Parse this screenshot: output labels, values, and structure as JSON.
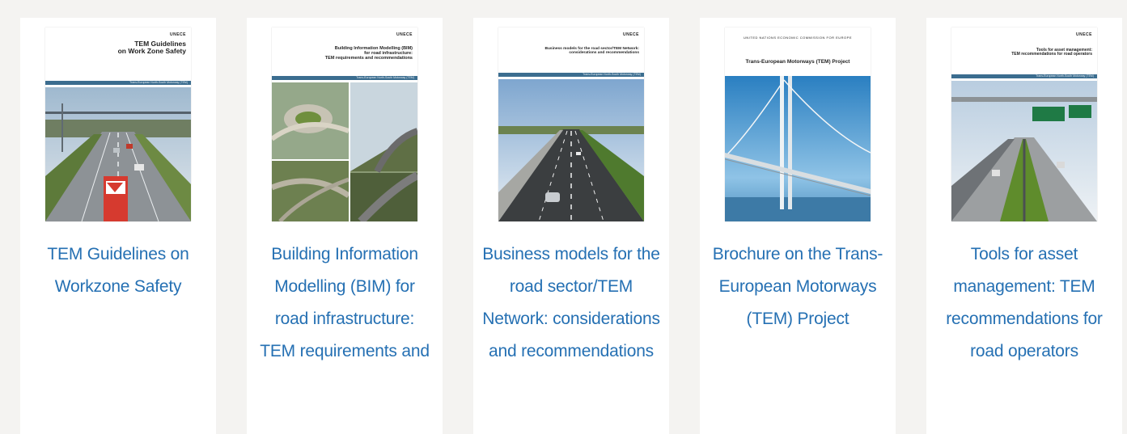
{
  "publications": [
    {
      "cover_brand": "UNECE",
      "cover_title_line1": "TEM Guidelines",
      "cover_title_line2": "on Work Zone Safety",
      "cover_band": "Trans-European North-South Motorway (TEM)",
      "label": "TEM Guidelines on Workzone Safety"
    },
    {
      "cover_brand": "UNECE",
      "cover_title_line1": "Building Information Modelling (BIM)",
      "cover_title_line2": "for road infrastructure:",
      "cover_title_line3": "TEM requirements and recommendations",
      "cover_band": "Trans-European North-South Motorway (TEM)",
      "label": "Building Information Modelling (BIM) for road infrastructure: TEM requirements and"
    },
    {
      "cover_brand": "UNECE",
      "cover_title_line1": "Business models for the road sector/TEM Network:",
      "cover_title_line2": "considerations and recommendations",
      "cover_band": "Trans-European North-South Motorway (TEM)",
      "label": "Business models for the road sector/TEM Network: considerations and recommendations"
    },
    {
      "cover_brand": "UNITED NATIONS ECONOMIC COMMISSION FOR EUROPE",
      "cover_title_line1": "Trans-European Motorways (TEM) Project",
      "label": "Brochure on the Trans-European Motorways (TEM) Project"
    },
    {
      "cover_brand": "UNECE",
      "cover_title_line1": "Tools for asset management:",
      "cover_title_line2": "TEM recommendations for road operators",
      "cover_band": "Trans-European North-South Motorway (TEM)",
      "label": "Tools for asset management: TEM recommendations for road operators"
    }
  ],
  "colors": {
    "page_background": "#f4f3f1",
    "card_background": "#ffffff",
    "link": "#2570b3",
    "cover_band": "#3b6d8f"
  }
}
